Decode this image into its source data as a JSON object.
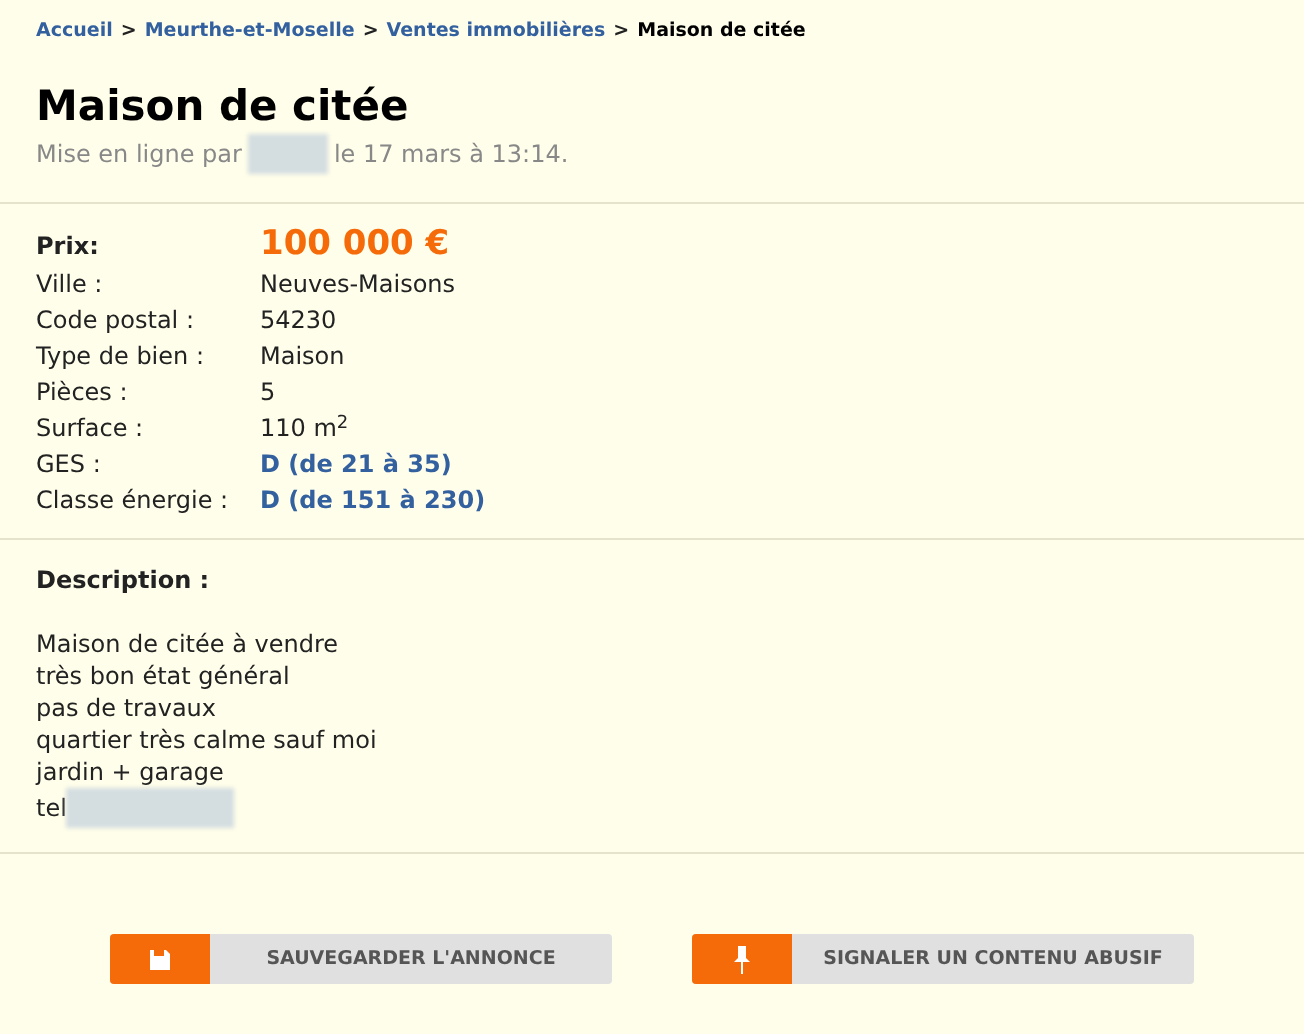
{
  "breadcrumb": {
    "links": [
      "Accueil",
      "Meurthe-et-Moselle",
      "Ventes immobilières"
    ],
    "separator": ">",
    "current": "Maison de citée"
  },
  "title": "Maison de citée",
  "posted": {
    "before": "Mise en ligne par",
    "after": "le 17 mars à 13:14."
  },
  "price": {
    "label": "Prix:",
    "value": "100 000 €"
  },
  "details": [
    {
      "label": "Ville :",
      "value": "Neuves-Maisons",
      "kind": "text"
    },
    {
      "label": "Code postal :",
      "value": "54230",
      "kind": "text"
    },
    {
      "label": "Type de bien :",
      "value": "Maison",
      "kind": "text"
    },
    {
      "label": "Pièces :",
      "value": "5",
      "kind": "text"
    },
    {
      "label": "Surface :",
      "value": "110 m$^{2}$",
      "kind": "text"
    },
    {
      "label": "GES :",
      "value": "D (de 21 à 35)",
      "kind": "rating"
    },
    {
      "label": "Classe énergie :",
      "value": "D (de 151 à 230)",
      "kind": "rating"
    }
  ],
  "description": {
    "heading": "Description :",
    "lines": [
      "Maison de citée à vendre",
      "très bon état général",
      "pas de travaux",
      "quartier très calme sauf moi",
      "jardin + garage",
      "tel"
    ]
  },
  "buttons": [
    {
      "label": "SAUVEGARDER L'ANNONCE",
      "kind": "save"
    },
    {
      "label": "SIGNALER UN CONTENU ABUSIF",
      "kind": "report"
    }
  ]
}
